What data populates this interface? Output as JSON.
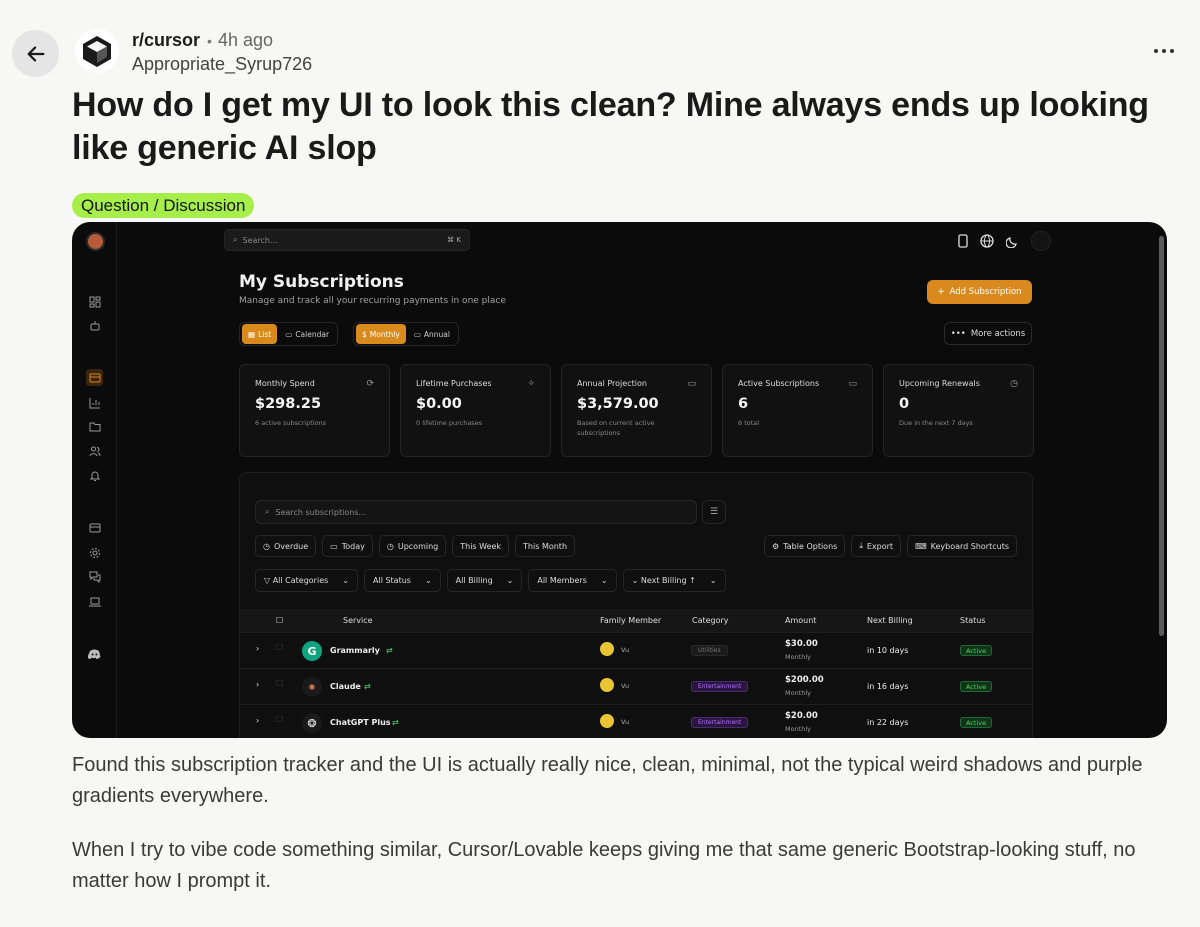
{
  "post": {
    "subreddit": "r/cursor",
    "time": "4h ago",
    "username": "Appropriate_Syrup726",
    "title": "How do I get my UI to look this clean? Mine always ends up looking like generic AI slop",
    "flair": "Question / Discussion",
    "body": [
      "Found this subscription tracker and the UI is actually really nice, clean, minimal, not the typical weird shadows and purple gradients everywhere.",
      "When I try to vibe code something similar, Cursor/Lovable keeps giving me that same generic Bootstrap-looking stuff, no matter how I prompt it."
    ]
  },
  "screenshot": {
    "search_placeholder": "Search...",
    "search_kbd": "⌘ K",
    "page_title": "My Subscriptions",
    "page_subtitle": "Manage and track all your recurring payments in one place",
    "add_button": "Add Subscription",
    "more_actions": "More actions",
    "view_toggle": [
      "List",
      "Calendar"
    ],
    "period_toggle": [
      "Monthly",
      "Annual"
    ],
    "stats": [
      {
        "label": "Monthly Spend",
        "value": "$298.25",
        "note": "6 active subscriptions",
        "icon": "refresh-icon"
      },
      {
        "label": "Lifetime Purchases",
        "value": "$0.00",
        "note": "0 lifetime purchases",
        "icon": "sparkle-icon"
      },
      {
        "label": "Annual Projection",
        "value": "$3,579.00",
        "note": "Based on current active subscriptions",
        "icon": "calendar-icon"
      },
      {
        "label": "Active Subscriptions",
        "value": "6",
        "note": "6 total",
        "icon": "card-icon"
      },
      {
        "label": "Upcoming Renewals",
        "value": "0",
        "note": "Due in the next 7 days",
        "icon": "clock-icon"
      }
    ],
    "table_search_placeholder": "Search subscriptions...",
    "quick_filters": [
      "Overdue",
      "Today",
      "Upcoming",
      "This Week",
      "This Month"
    ],
    "tools": [
      "Table Options",
      "Export",
      "Keyboard Shortcuts"
    ],
    "dropdowns": [
      "All Categories",
      "All Status",
      "All Billing",
      "All Members",
      "Next Billing ↑"
    ],
    "columns": [
      "Service",
      "Family Member",
      "Category",
      "Amount",
      "Next Billing",
      "Status"
    ],
    "rows": [
      {
        "service": "Grammarly",
        "member": "Vu",
        "category": "Utilities",
        "amount": "$30.00",
        "period": "Monthly",
        "next": "in 10 days",
        "status": "Active",
        "logo_bg": "#0fa37f",
        "logo": "G"
      },
      {
        "service": "Claude",
        "member": "Vu",
        "category": "Entertainment",
        "amount": "$200.00",
        "period": "Monthly",
        "next": "in 16 days",
        "status": "Active",
        "logo_bg": "#1a1a1a",
        "logo": "✷"
      },
      {
        "service": "ChatGPT Plus",
        "member": "Vu",
        "category": "Entertainment",
        "amount": "$20.00",
        "period": "Monthly",
        "next": "in 22 days",
        "status": "Active",
        "logo_bg": "#1a1a1a",
        "logo": "❂"
      }
    ],
    "colors": {
      "accent": "#d98a1c",
      "background": "#0b0b0b",
      "flair": "#a6ef4a"
    }
  }
}
